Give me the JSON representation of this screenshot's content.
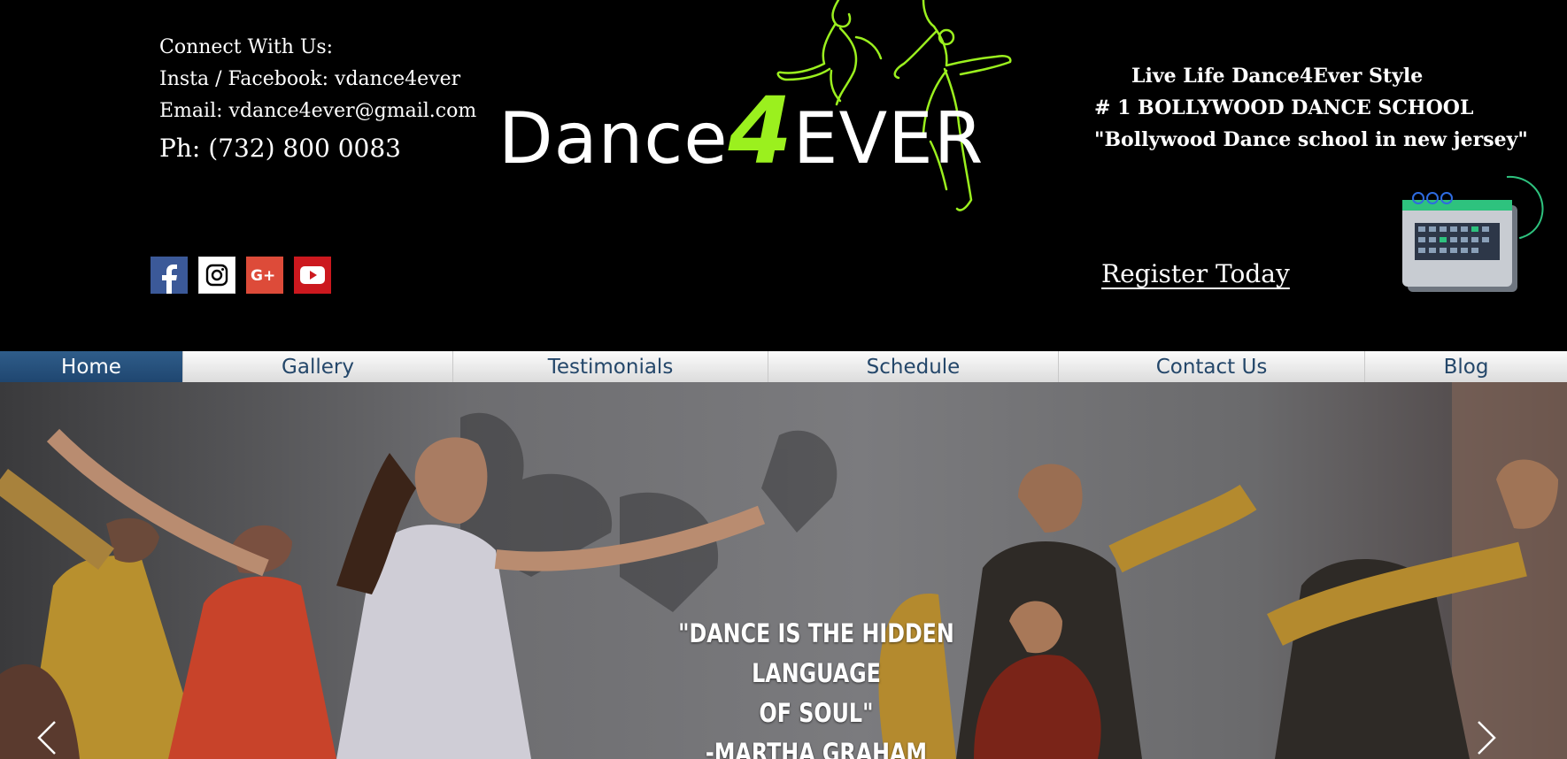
{
  "contact": {
    "heading": "Connect With Us:",
    "social_line": "Insta / Facebook: vdance4ever",
    "email_line": "Email: vdance4ever@gmail.com",
    "phone_line": "Ph: (732) 800 0083"
  },
  "social_icons": [
    "facebook-icon",
    "instagram-icon",
    "google-plus-icon",
    "youtube-icon"
  ],
  "logo": {
    "text_left": "Dance",
    "text_four": "4",
    "text_right": "EVER"
  },
  "tagline": {
    "line1": "Live Life Dance4Ever Style",
    "line2": "# 1 BOLLYWOOD DANCE SCHOOL",
    "line3": "\"Bollywood Dance school in new jersey\""
  },
  "register_label": "Register Today",
  "nav": [
    {
      "label": "Home",
      "active": true
    },
    {
      "label": "Gallery"
    },
    {
      "label": "Testimonials"
    },
    {
      "label": "Schedule"
    },
    {
      "label": "Contact Us"
    },
    {
      "label": "Blog"
    }
  ],
  "hero": {
    "quote_line1": "\"DANCE IS THE HIDDEN LANGUAGE",
    "quote_line2": "OF SOUL\"",
    "quote_line3": "-MARTHA GRAHAM"
  },
  "colors": {
    "background": "#000000",
    "logo_accent": "#9bf01e",
    "nav_active": "#2f5d8a",
    "nav_text": "#24476a",
    "calendar_accent": "#2ec27e"
  }
}
